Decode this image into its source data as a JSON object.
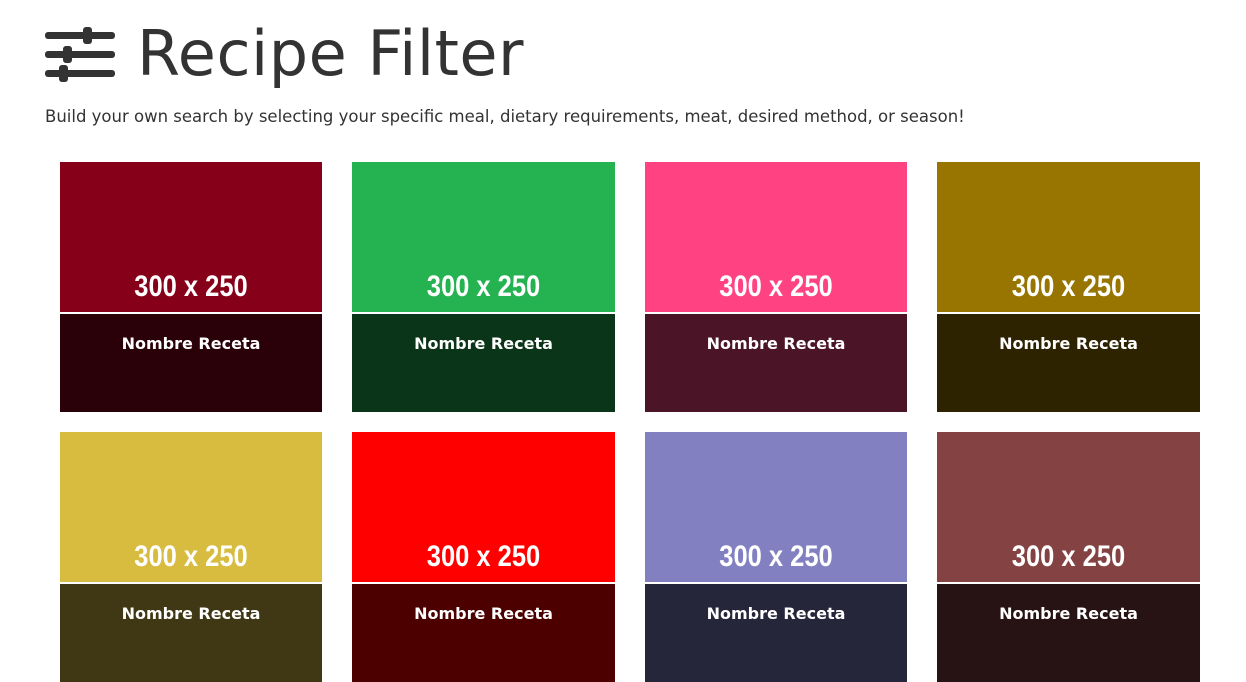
{
  "header": {
    "icon": "sliders-filter-icon",
    "title": "Recipe Filter",
    "subtitle": "Build your own search by selecting your specific meal, dietary requirements, meat, desired method, or season!"
  },
  "cards": [
    {
      "image_label": "300 x 250",
      "name": "Nombre Receta",
      "image_color": "#87001a",
      "caption_color": "#2a0009"
    },
    {
      "image_label": "300 x 250",
      "name": "Nombre Receta",
      "image_color": "#25b251",
      "caption_color": "#0b3518"
    },
    {
      "image_label": "300 x 250",
      "name": "Nombre Receta",
      "image_color": "#ff4281",
      "caption_color": "#4c1427"
    },
    {
      "image_label": "300 x 250",
      "name": "Nombre Receta",
      "image_color": "#987400",
      "caption_color": "#2d2300"
    },
    {
      "image_label": "300 x 250",
      "name": "Nombre Receta",
      "image_color": "#d8bc40",
      "caption_color": "#403814"
    },
    {
      "image_label": "300 x 250",
      "name": "Nombre Receta",
      "image_color": "#ff0000",
      "caption_color": "#4c0000"
    },
    {
      "image_label": "300 x 250",
      "name": "Nombre Receta",
      "image_color": "#8280c1",
      "caption_color": "#26263a"
    },
    {
      "image_label": "300 x 250",
      "name": "Nombre Receta",
      "image_color": "#844242",
      "caption_color": "#271313"
    }
  ]
}
